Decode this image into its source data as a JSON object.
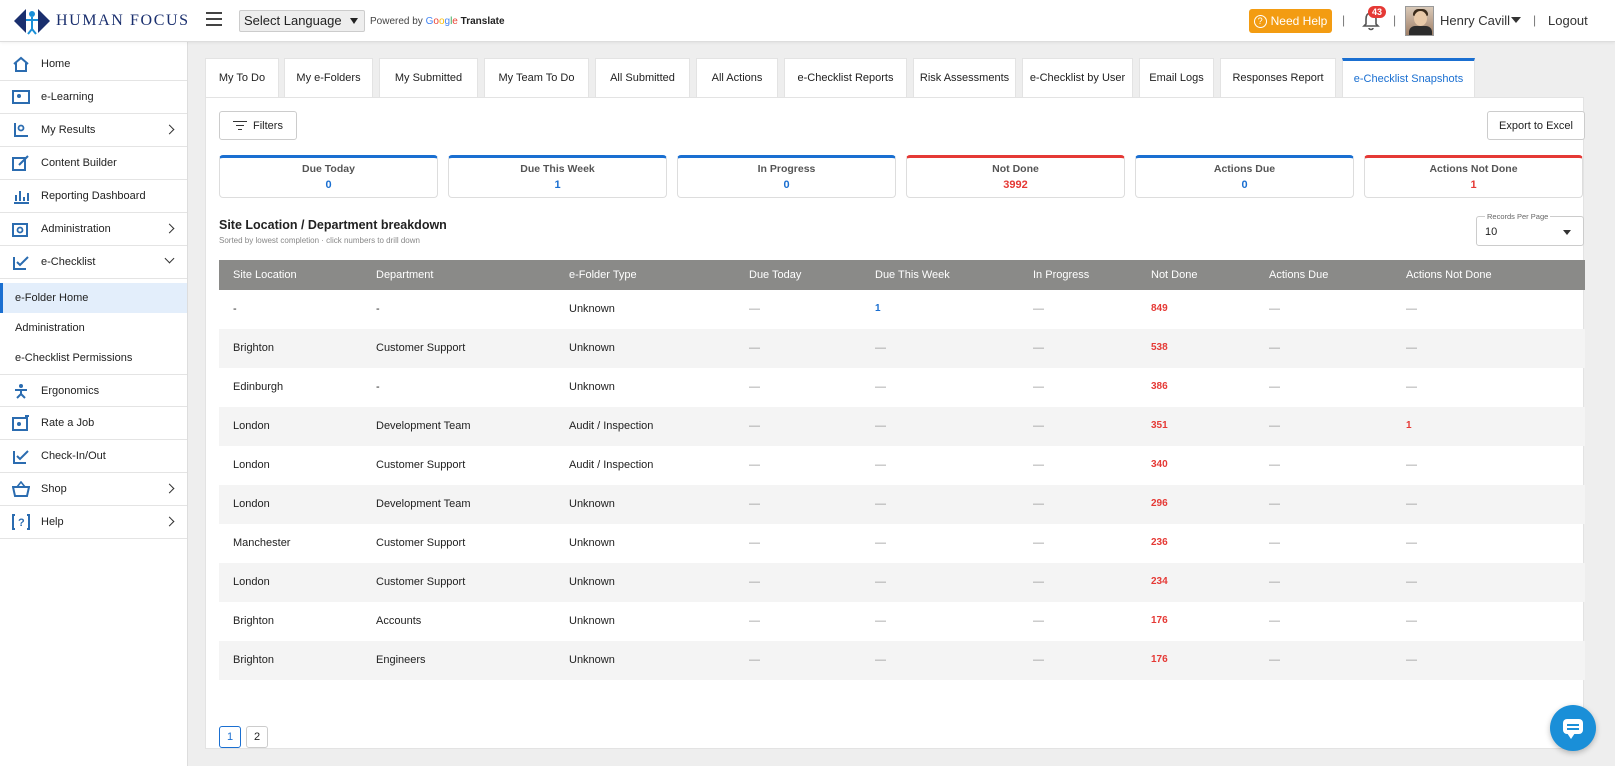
{
  "header": {
    "logo_text": "HUMAN FOCUS",
    "language_select": "Select Language",
    "powered_by": "Powered by",
    "google_letters": [
      "G",
      "o",
      "o",
      "g",
      "l",
      "e"
    ],
    "translate": "Translate",
    "need_help": "Need Help",
    "notification_count": "43",
    "user_name": "Henry Cavill",
    "logout": "Logout",
    "separator": "|"
  },
  "sidebar": {
    "items": [
      {
        "label": "Home",
        "icon": "home-icon"
      },
      {
        "label": "e-Learning",
        "icon": "elearning-icon"
      },
      {
        "label": "My Results",
        "icon": "results-icon"
      },
      {
        "label": "Content Builder",
        "icon": "content-builder-icon"
      },
      {
        "label": "Reporting Dashboard",
        "icon": "bar-chart-icon"
      },
      {
        "label": "Administration",
        "icon": "administration-icon"
      },
      {
        "label": "e-Checklist",
        "icon": "checklist-icon"
      }
    ],
    "subitems": [
      {
        "label": "e-Folder Home"
      },
      {
        "label": "Administration"
      },
      {
        "label": "e-Checklist Permissions"
      }
    ],
    "items2": [
      {
        "label": "Ergonomics",
        "icon": "ergonomics-icon"
      },
      {
        "label": "Rate a Job",
        "icon": "rate-job-icon"
      },
      {
        "label": "Check-In/Out",
        "icon": "checkin-icon"
      },
      {
        "label": "Shop",
        "icon": "shop-icon"
      },
      {
        "label": "Help",
        "icon": "help-icon"
      }
    ]
  },
  "tabs": [
    "My To Do",
    "My e-Folders",
    "My Submitted",
    "My Team To Do",
    "All Submitted",
    "All Actions",
    "e-Checklist Reports",
    "Risk Assessments",
    "e-Checklist by User",
    "Email Logs",
    "Responses Report",
    "e-Checklist Snapshots"
  ],
  "toolbar": {
    "filters": "Filters",
    "export": "Export to Excel"
  },
  "cards": [
    {
      "label": "Due Today",
      "value": "0"
    },
    {
      "label": "Due This Week",
      "value": "1"
    },
    {
      "label": "In Progress",
      "value": "0"
    },
    {
      "label": "Not Done",
      "value": "3992"
    },
    {
      "label": "Actions Due",
      "value": "0"
    },
    {
      "label": "Actions Not Done",
      "value": "1"
    }
  ],
  "section": {
    "title": "Site Location / Department breakdown",
    "subtitle": "Sorted by lowest completion · click numbers to drill down",
    "records_per_page_label": "Records Per Page",
    "records_per_page_value": "10"
  },
  "table": {
    "columns": [
      "Site Location",
      "Department",
      "e-Folder Type",
      "Due Today",
      "Due This Week",
      "In Progress",
      "Not Done",
      "Actions Due",
      "Actions Not Done"
    ],
    "rows": [
      [
        "-",
        "-",
        "Unknown",
        "—",
        "1",
        "—",
        "849",
        "—",
        "—"
      ],
      [
        "Brighton",
        "Customer Support",
        "Unknown",
        "—",
        "—",
        "—",
        "538",
        "—",
        "—"
      ],
      [
        "Edinburgh",
        "-",
        "Unknown",
        "—",
        "—",
        "—",
        "386",
        "—",
        "—"
      ],
      [
        "London",
        "Development Team",
        "Audit / Inspection",
        "—",
        "—",
        "—",
        "351",
        "—",
        "1"
      ],
      [
        "London",
        "Customer Support",
        "Audit / Inspection",
        "—",
        "—",
        "—",
        "340",
        "—",
        "—"
      ],
      [
        "London",
        "Development Team",
        "Unknown",
        "—",
        "—",
        "—",
        "296",
        "—",
        "—"
      ],
      [
        "Manchester",
        "Customer Support",
        "Unknown",
        "—",
        "—",
        "—",
        "236",
        "—",
        "—"
      ],
      [
        "London",
        "Customer Support",
        "Unknown",
        "—",
        "—",
        "—",
        "234",
        "—",
        "—"
      ],
      [
        "Brighton",
        "Accounts",
        "Unknown",
        "—",
        "—",
        "—",
        "176",
        "—",
        "—"
      ],
      [
        "Brighton",
        "Engineers",
        "Unknown",
        "—",
        "—",
        "—",
        "176",
        "—",
        "—"
      ]
    ]
  },
  "pagination": [
    "1",
    "2"
  ],
  "colors": {
    "accent": "#1a6fd1",
    "danger": "#e53935",
    "help": "#f39c12",
    "table_header": "#8a8a88"
  }
}
